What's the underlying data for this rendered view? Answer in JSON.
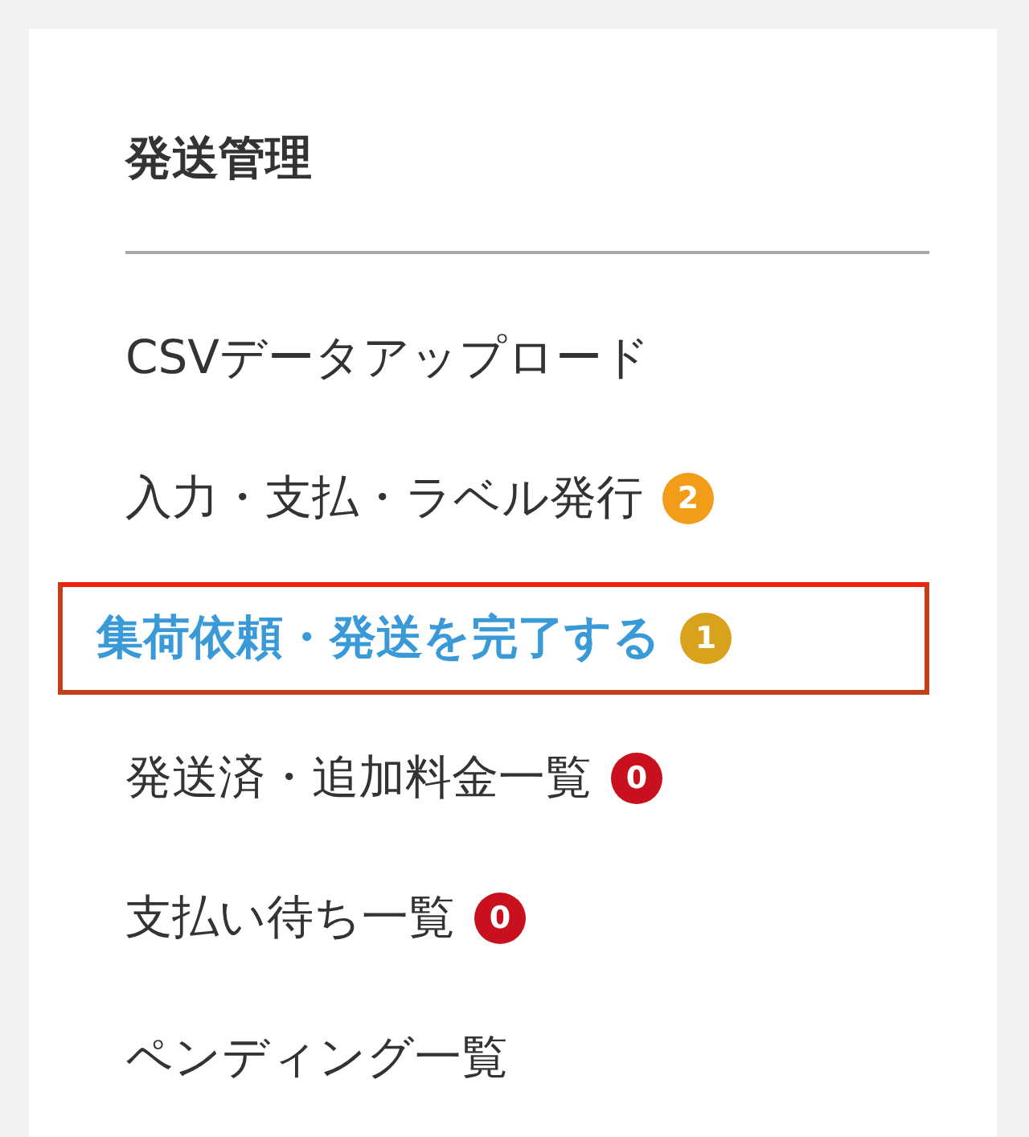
{
  "panel": {
    "title": "発送管理",
    "items": [
      {
        "label": "CSVデータアップロード",
        "selected": false
      },
      {
        "label": "入力・支払・ラベル発行",
        "selected": false,
        "badge": "2",
        "color": "#f39c1a"
      },
      {
        "label": "集荷依頼・発送を完了する",
        "selected": true,
        "badge": "1",
        "color": "#d9a21c"
      },
      {
        "label": "発送済・追加料金一覧",
        "selected": false,
        "badge": "0",
        "color": "#c8101e"
      },
      {
        "label": "支払い待ち一覧",
        "selected": false,
        "badge": "0",
        "color": "#c8101e"
      },
      {
        "label": "ペンディング一覧",
        "selected": false
      }
    ]
  }
}
